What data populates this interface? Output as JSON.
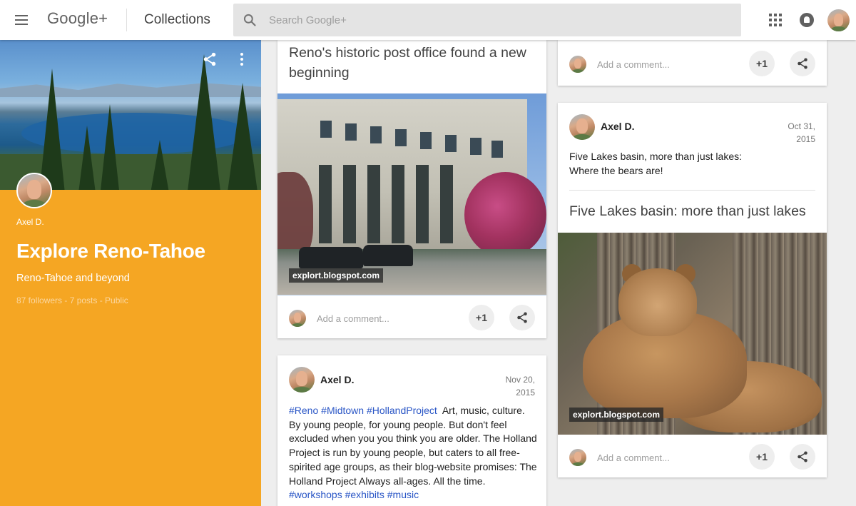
{
  "header": {
    "logo": "Google+",
    "section": "Collections",
    "search_placeholder": "Search Google+"
  },
  "collection": {
    "owner": "Axel D.",
    "title": "Explore Reno-Tahoe",
    "tagline": "Reno-Tahoe and beyond",
    "meta": "87 followers - 7 posts - Public",
    "accent_color": "#f5a623"
  },
  "posts": {
    "post_office": {
      "title": "Reno's historic post office found a new beginning",
      "photo_credit": "explort.blogspot.com",
      "comment_placeholder": "Add a comment...",
      "plus_one": "+1"
    },
    "holland": {
      "author": "Axel D.",
      "date_line1": "Nov 20,",
      "date_line2": "2015",
      "tag1": "#Reno",
      "tag2": "#Midtown",
      "tag3": "#HollandProject",
      "body": "Art, music, culture. By young people, for young people. But don't feel excluded when you you think you are older. The Holland Project is run by young people, but caters to all free-spirited age groups, as their blog-website promises: The Holland Project Always all-ages. All the time.",
      "tag4": "#workshops",
      "tag5": "#exhibits",
      "tag6": "#music"
    },
    "top_right": {
      "comment_placeholder": "Add a comment...",
      "plus_one": "+1"
    },
    "five_lakes": {
      "author": "Axel D.",
      "date_line1": "Oct 31,",
      "date_line2": "2015",
      "text_line1": "Five Lakes basin, more than just lakes:",
      "text_line2": "Where the bears are!",
      "title": "Five Lakes basin: more than just lakes",
      "photo_credit": "explort.blogspot.com",
      "comment_placeholder": "Add a comment...",
      "plus_one": "+1"
    }
  },
  "icons": {
    "menu": "hamburger-icon",
    "search": "search-icon",
    "apps": "apps-grid-icon",
    "notifications": "bell-icon",
    "share": "share-icon",
    "more": "more-vert-icon"
  },
  "colors": {
    "hashtag": "#2a56c6",
    "background": "#eeeeee"
  }
}
